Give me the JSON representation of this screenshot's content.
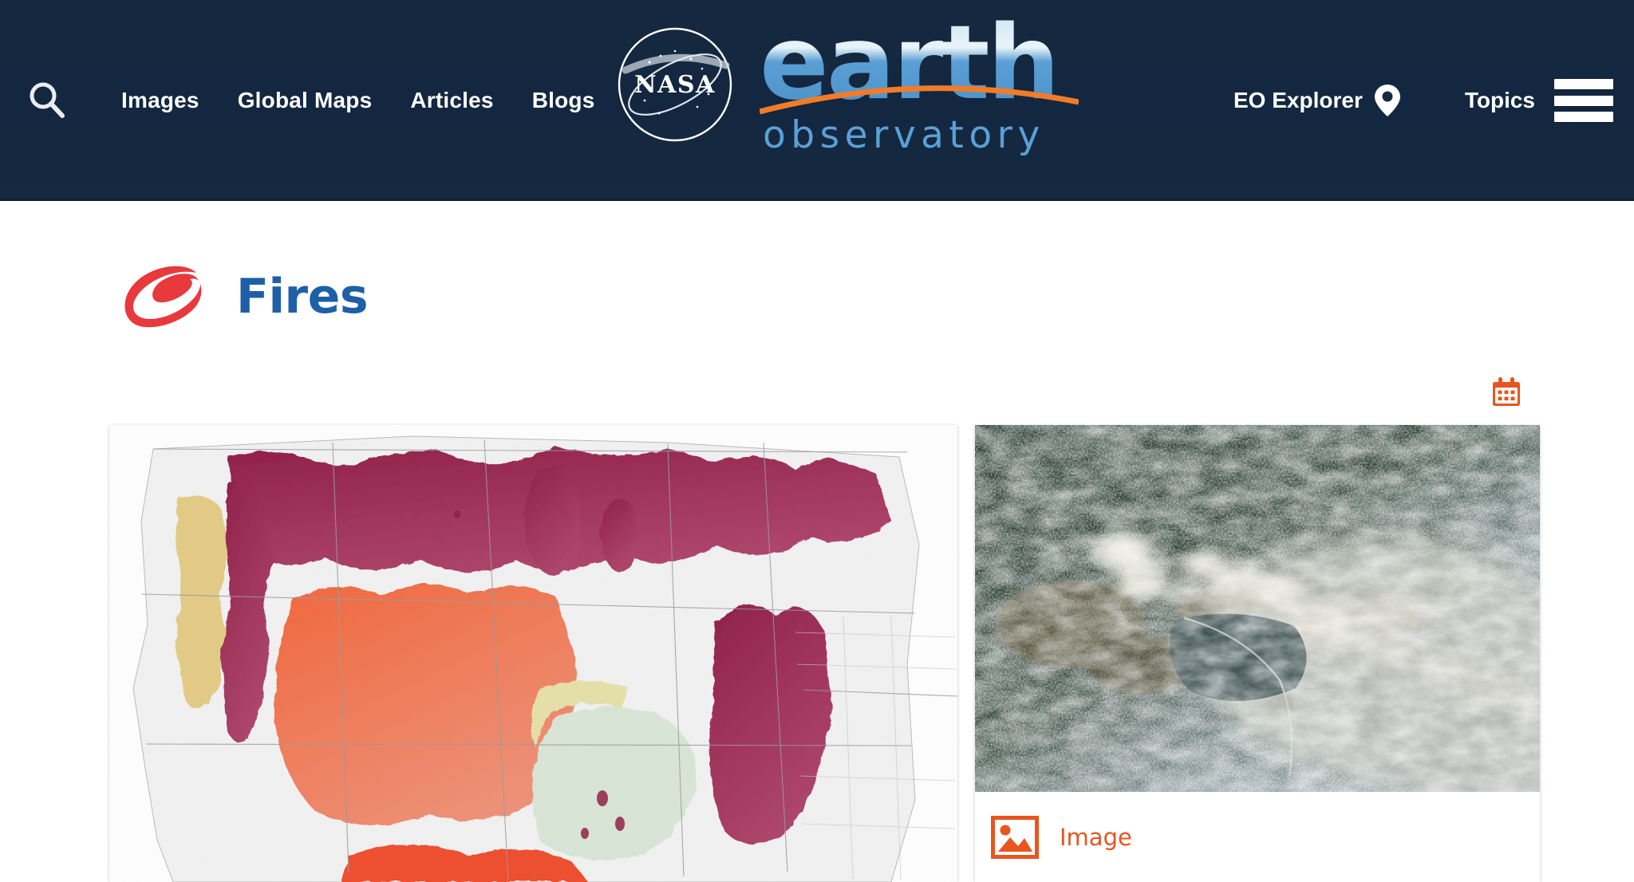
{
  "header": {
    "background_color": "#132741",
    "search_icon": "search-icon",
    "nav_links": [
      {
        "label": "Images"
      },
      {
        "label": "Global Maps"
      },
      {
        "label": "Articles"
      },
      {
        "label": "Blogs"
      }
    ],
    "logo": {
      "agency": "NASA",
      "word_earth": "earth",
      "word_observatory": "observatory",
      "earth_color": "#4a90c8",
      "accent_arc_color": "#f07c2a"
    },
    "eo_explorer": {
      "label": "EO Explorer",
      "icon": "map-pin-icon"
    },
    "topics": {
      "label": "Topics",
      "icon": "hamburger-menu-icon"
    }
  },
  "page": {
    "title": "Fires",
    "title_color": "#1e5fa8",
    "mark_icon": "fires-flame-logo",
    "mark_color": "#e8393c"
  },
  "toolbar": {
    "calendar_icon": "calendar-icon",
    "calendar_color": "#e8551f"
  },
  "cards": {
    "left": {
      "name": "drought-fire-map",
      "alt": "Shaded relief map of the western United States with colored drought and fire risk regions",
      "legend_colors": {
        "severe": "#8e1b45",
        "high": "#f05a32",
        "moderate": "#e9cf84",
        "low": "#d9e6d6"
      }
    },
    "right": {
      "name": "satellite-smoke-image",
      "alt": "Satellite view of wildfire smoke plumes drifting over dark green boreal forest",
      "caption": {
        "label": "Image",
        "icon": "picture-icon",
        "color": "#e8551f"
      }
    }
  }
}
